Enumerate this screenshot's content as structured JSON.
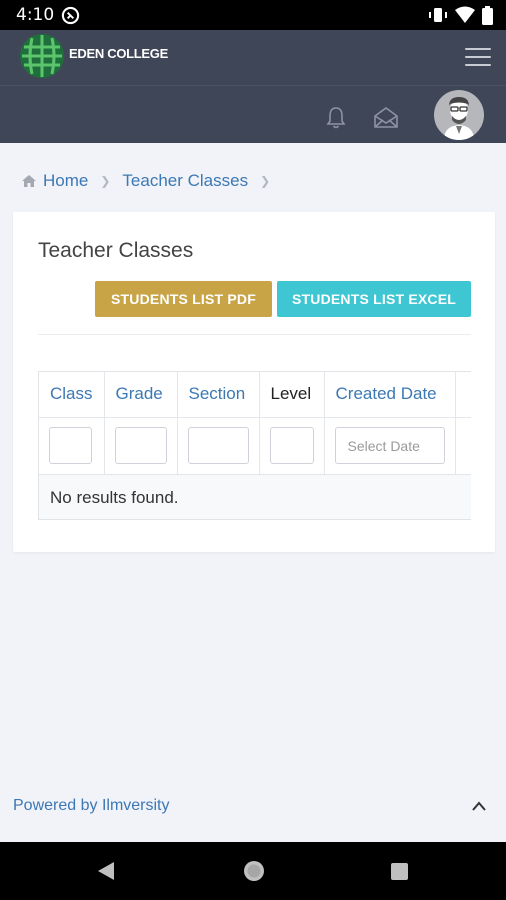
{
  "status_bar": {
    "time": "4:10"
  },
  "header": {
    "brand": "EDEN COLLEGE",
    "icons": [
      "bell-icon",
      "envelope-icon",
      "hamburger-icon"
    ]
  },
  "breadcrumb": {
    "home": "Home",
    "current": "Teacher Classes"
  },
  "card": {
    "title": "Teacher Classes",
    "pdf_button": "STUDENTS LIST PDF",
    "excel_button": "STUDENTS LIST EXCEL"
  },
  "table": {
    "columns": [
      "Class",
      "Grade",
      "Section",
      "Level",
      "Created Date"
    ],
    "date_placeholder": "Select Date",
    "empty_message": "No results found."
  },
  "footer": {
    "powered_by": "Powered by Ilmversity"
  },
  "colors": {
    "header_bg": "#3f4657",
    "pdf_button": "#c9a447",
    "excel_button": "#3ec6d3",
    "link": "#3c78b4",
    "page_bg": "#f1f3f8"
  }
}
